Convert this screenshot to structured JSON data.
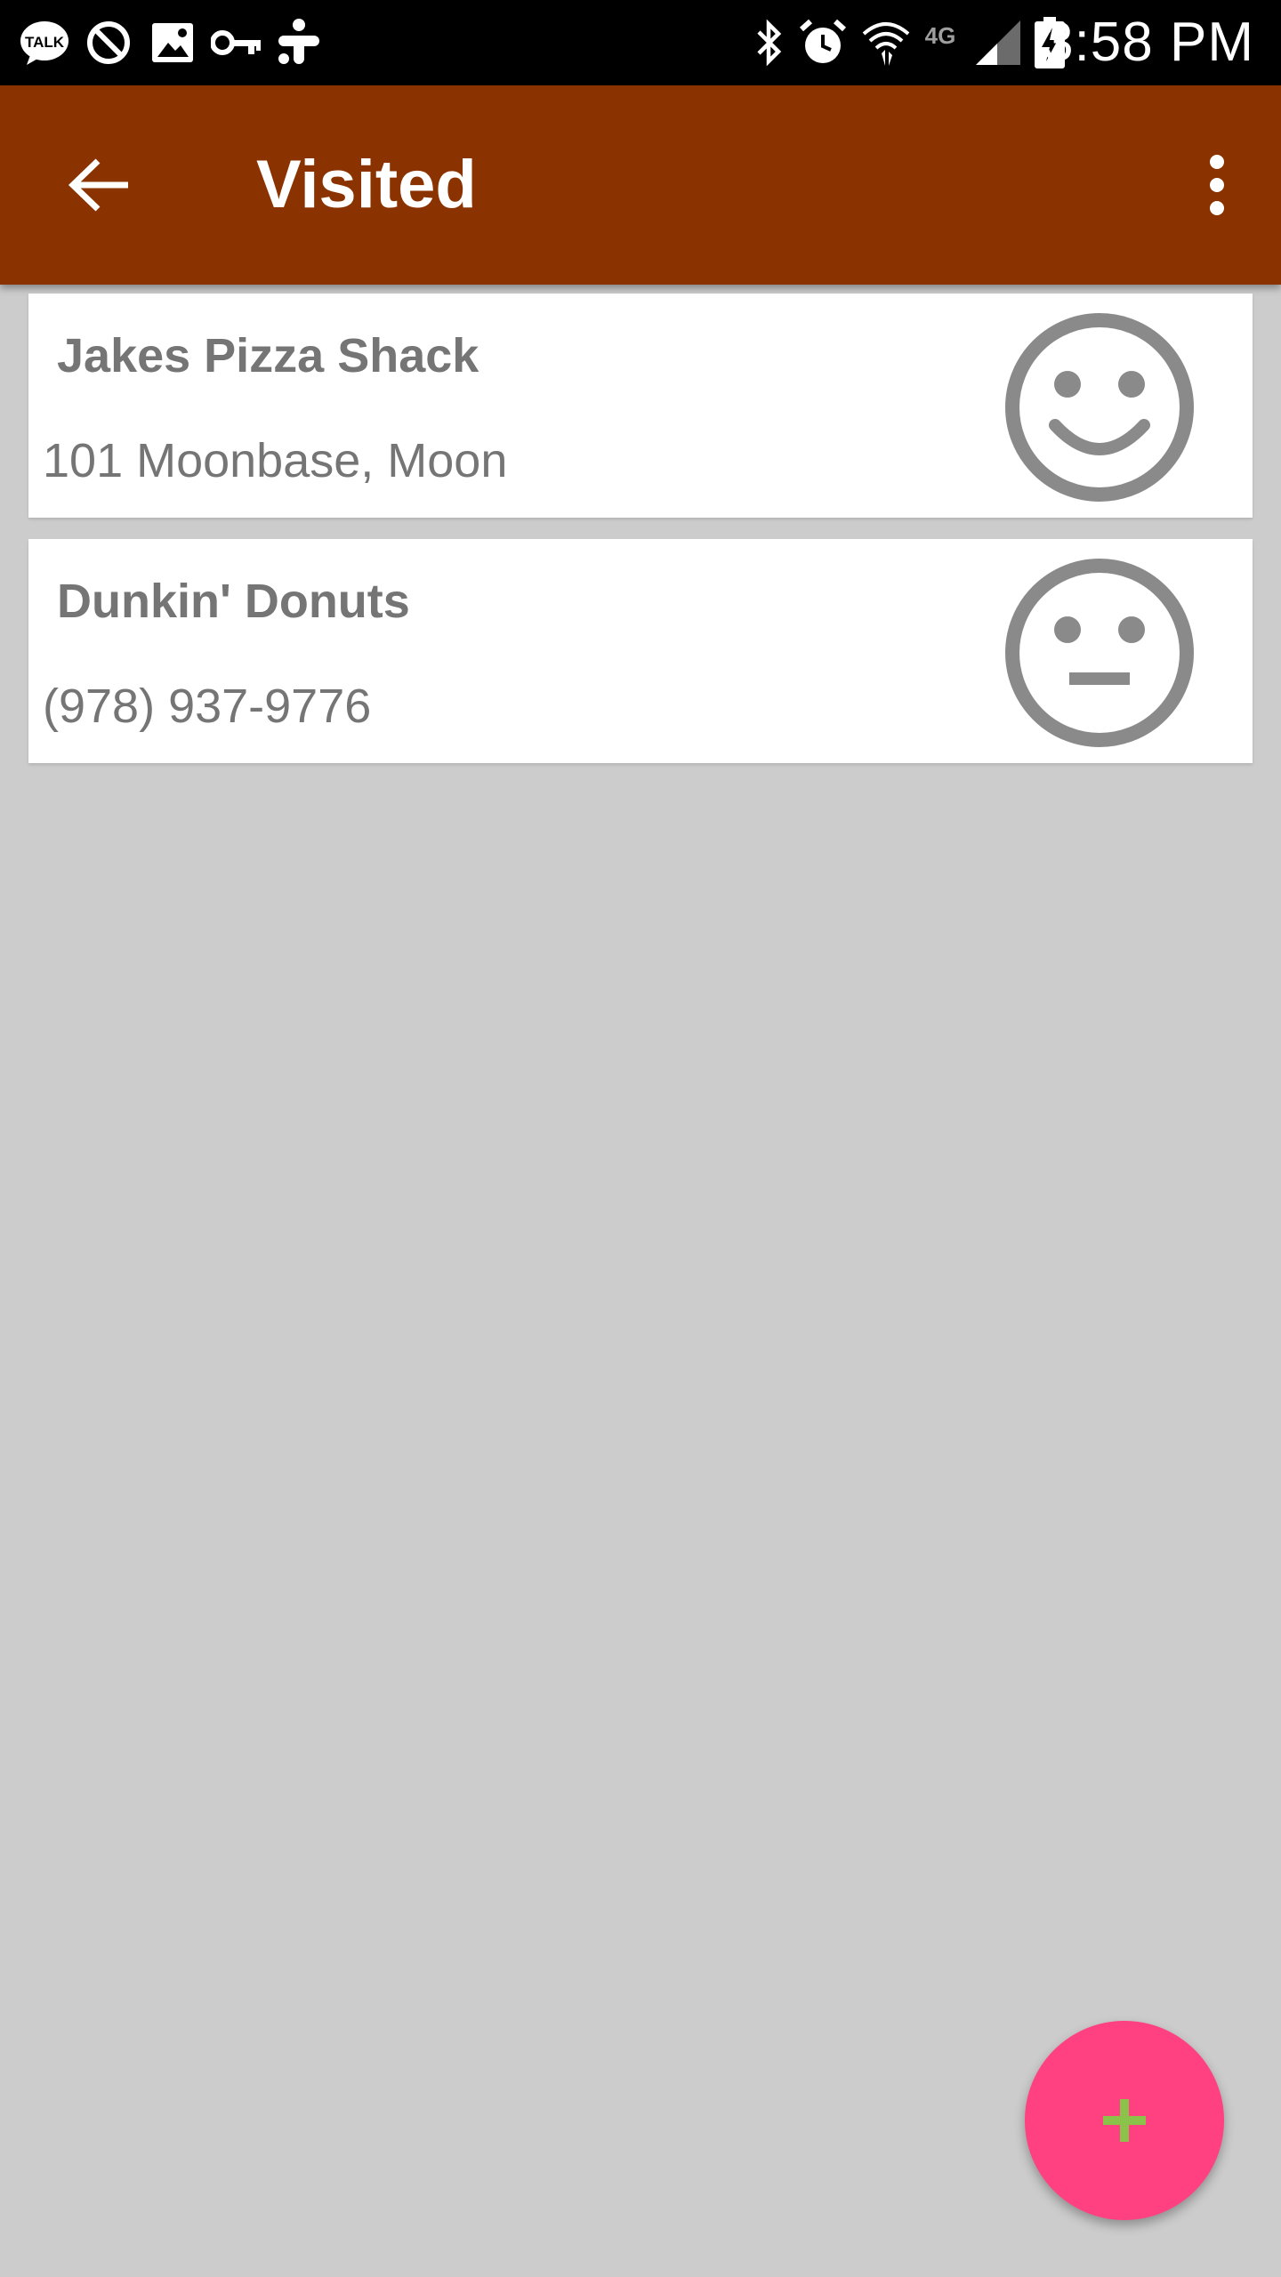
{
  "status_bar": {
    "time": "3:58 PM",
    "network_label": "4G",
    "left_icons": [
      "talk-icon",
      "do-not-disturb-icon",
      "image-icon",
      "key-icon",
      "plus-cluster-icon"
    ],
    "right_icons": [
      "bluetooth-icon",
      "alarm-icon",
      "wifi-icon",
      "network-4g-icon",
      "signal-icon",
      "battery-charging-icon"
    ]
  },
  "app_bar": {
    "title": "Visited",
    "back_icon": "arrow-back-icon",
    "menu_icon": "more-vert-icon",
    "background_color": "#8b3300"
  },
  "places": [
    {
      "name": "Jakes Pizza Shack",
      "detail": "101 Moonbase, Moon",
      "rating_icon": "happy-face-icon"
    },
    {
      "name": "Dunkin' Donuts",
      "detail": "(978) 937-9776",
      "rating_icon": "neutral-face-icon"
    }
  ],
  "fab": {
    "icon": "add-icon",
    "background_color": "#ff4081",
    "icon_color": "#8bc34a"
  }
}
